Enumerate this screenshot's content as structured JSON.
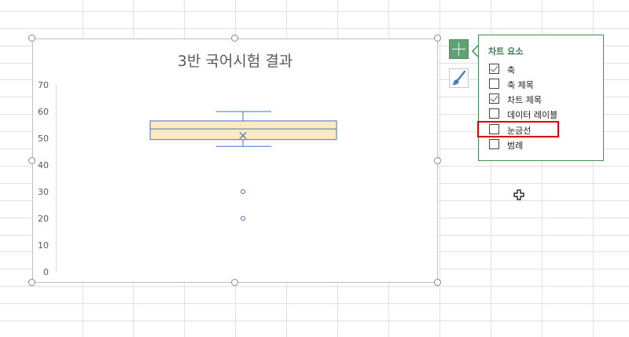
{
  "chart": {
    "title": "3반 국어시험 결과"
  },
  "chart_data": {
    "type": "box",
    "title": "3반 국어시험 결과",
    "xlabel": "",
    "ylabel": "",
    "ylim": [
      0,
      70
    ],
    "yticks": [
      0,
      10,
      20,
      30,
      40,
      50,
      60,
      70
    ],
    "box": {
      "whisker_low": 47,
      "q1": 49.5,
      "median": 53.5,
      "q3": 56.5,
      "whisker_high": 60,
      "mean": 51,
      "outliers": [
        30,
        20
      ]
    },
    "grid": false,
    "legend": "none",
    "colors": {
      "box_fill": "#fde9c2",
      "box_stroke": "#4472c4",
      "axis_text": "#595959"
    }
  },
  "panel": {
    "title": "차트 요소",
    "options": [
      {
        "label": "축",
        "checked": true
      },
      {
        "label": "축 제목",
        "checked": false
      },
      {
        "label": "차트 제목",
        "checked": true
      },
      {
        "label": "데이터 레이블",
        "checked": false
      },
      {
        "label": "눈금선",
        "checked": false
      },
      {
        "label": "범례",
        "checked": false
      }
    ]
  },
  "colors": {
    "accent_green": "#5fa374",
    "highlight_red": "#e00000"
  },
  "icons": [
    "plus-icon",
    "brush-icon",
    "move-cursor-icon"
  ]
}
